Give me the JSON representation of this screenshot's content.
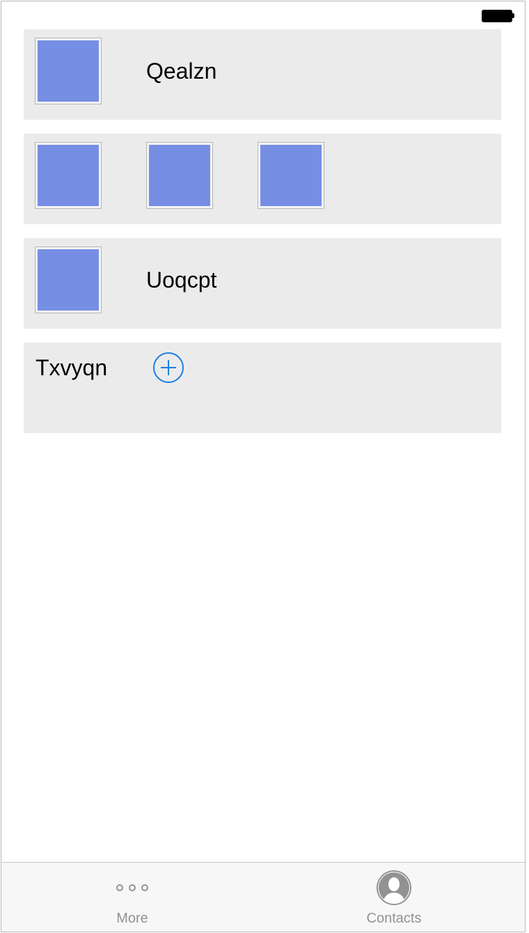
{
  "status_bar": {
    "battery_icon": "battery-full-icon"
  },
  "rows": [
    {
      "title": "Qealzn",
      "thumbnails": 1
    },
    {
      "title": "",
      "thumbnails": 3
    },
    {
      "title": "Uoqcpt",
      "thumbnails": 1
    },
    {
      "title": "Txvyqn",
      "action_icon": "add-circle-icon"
    }
  ],
  "tab_bar": {
    "tabs": [
      {
        "label": "More",
        "icon": "more-icon"
      },
      {
        "label": "Contacts",
        "icon": "contacts-icon"
      }
    ]
  },
  "colors": {
    "thumbnail": "#768ee4",
    "row_background": "#ebebeb",
    "accent": "#1a7ee3",
    "tab_label": "#929292"
  }
}
